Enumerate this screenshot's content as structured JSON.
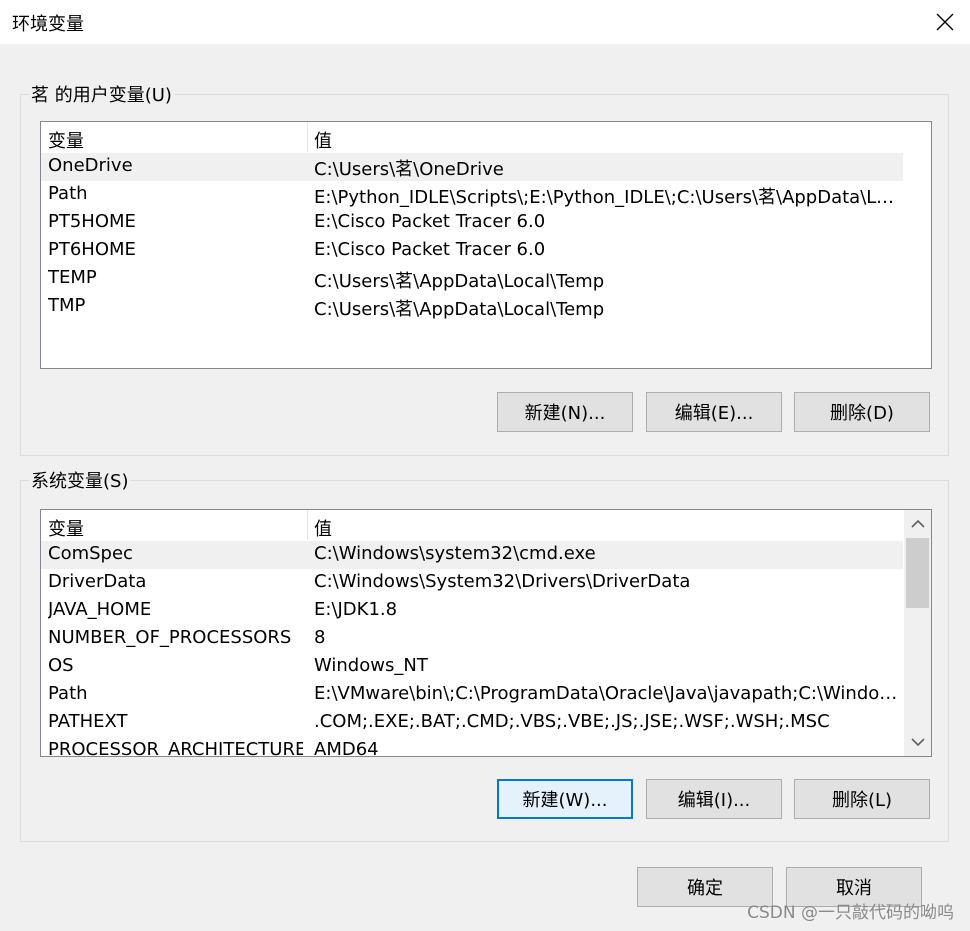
{
  "window": {
    "title": "环境变量"
  },
  "user_vars": {
    "group_label": "茗 的用户变量(U)",
    "header": {
      "name": "变量",
      "value": "值"
    },
    "rows": [
      {
        "name": "OneDrive",
        "value": "C:\\Users\\茗\\OneDrive",
        "selected": true
      },
      {
        "name": "Path",
        "value": "E:\\Python_IDLE\\Scripts\\;E:\\Python_IDLE\\;C:\\Users\\茗\\AppData\\Loca..."
      },
      {
        "name": "PT5HOME",
        "value": "E:\\Cisco Packet Tracer 6.0"
      },
      {
        "name": "PT6HOME",
        "value": "E:\\Cisco Packet Tracer 6.0"
      },
      {
        "name": "TEMP",
        "value": "C:\\Users\\茗\\AppData\\Local\\Temp"
      },
      {
        "name": "TMP",
        "value": "C:\\Users\\茗\\AppData\\Local\\Temp"
      }
    ],
    "buttons": {
      "new": "新建(N)...",
      "edit": "编辑(E)...",
      "delete": "删除(D)"
    }
  },
  "system_vars": {
    "group_label": "系统变量(S)",
    "header": {
      "name": "变量",
      "value": "值"
    },
    "rows": [
      {
        "name": "ComSpec",
        "value": "C:\\Windows\\system32\\cmd.exe",
        "selected": true
      },
      {
        "name": "DriverData",
        "value": "C:\\Windows\\System32\\Drivers\\DriverData"
      },
      {
        "name": "JAVA_HOME",
        "value": "E:\\JDK1.8"
      },
      {
        "name": "NUMBER_OF_PROCESSORS",
        "value": "8"
      },
      {
        "name": "OS",
        "value": "Windows_NT"
      },
      {
        "name": "Path",
        "value": "E:\\VMware\\bin\\;C:\\ProgramData\\Oracle\\Java\\javapath;C:\\Windows..."
      },
      {
        "name": "PATHEXT",
        "value": ".COM;.EXE;.BAT;.CMD;.VBS;.VBE;.JS;.JSE;.WSF;.WSH;.MSC"
      },
      {
        "name": "PROCESSOR_ARCHITECTURE",
        "value": "AMD64"
      }
    ],
    "buttons": {
      "new": "新建(W)...",
      "edit": "编辑(I)...",
      "delete": "删除(L)"
    }
  },
  "dialog_buttons": {
    "ok": "确定",
    "cancel": "取消"
  },
  "watermark": "CSDN @一只敲代码的呦呜"
}
